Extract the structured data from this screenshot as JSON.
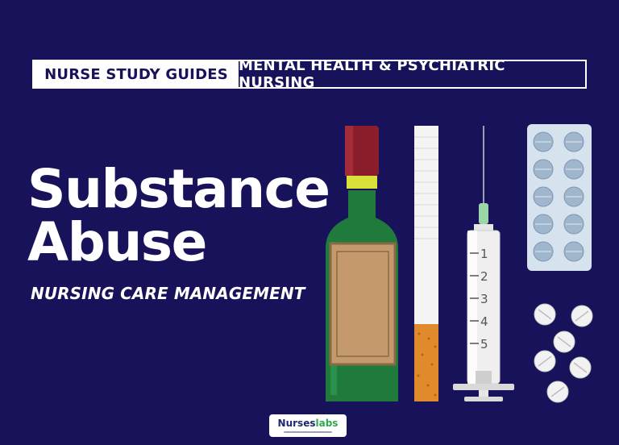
{
  "banner": {
    "left_label": "NURSE STUDY GUIDES",
    "right_label": "MENTAL HEALTH & PSYCHIATRIC NURSING"
  },
  "title": {
    "line1": "Substance",
    "line2": "Abuse"
  },
  "subtitle": "NURSING CARE MANAGEMENT",
  "syringe_scale": [
    "1",
    "2",
    "3",
    "4",
    "5"
  ],
  "logo": {
    "name_part1": "Nurses",
    "name_part2": "labs"
  },
  "colors": {
    "background": "#17125a",
    "bottle_green": "#1f7a3c",
    "bottle_cap": "#8a1e2b",
    "label_tan": "#c49a6c",
    "filter_orange": "#e08a2c",
    "brand_green": "#2fa84f"
  },
  "icons": [
    "wine-bottle-icon",
    "cigarette-icon",
    "syringe-icon",
    "pill-blister-pack-icon",
    "loose-pills-icon"
  ]
}
